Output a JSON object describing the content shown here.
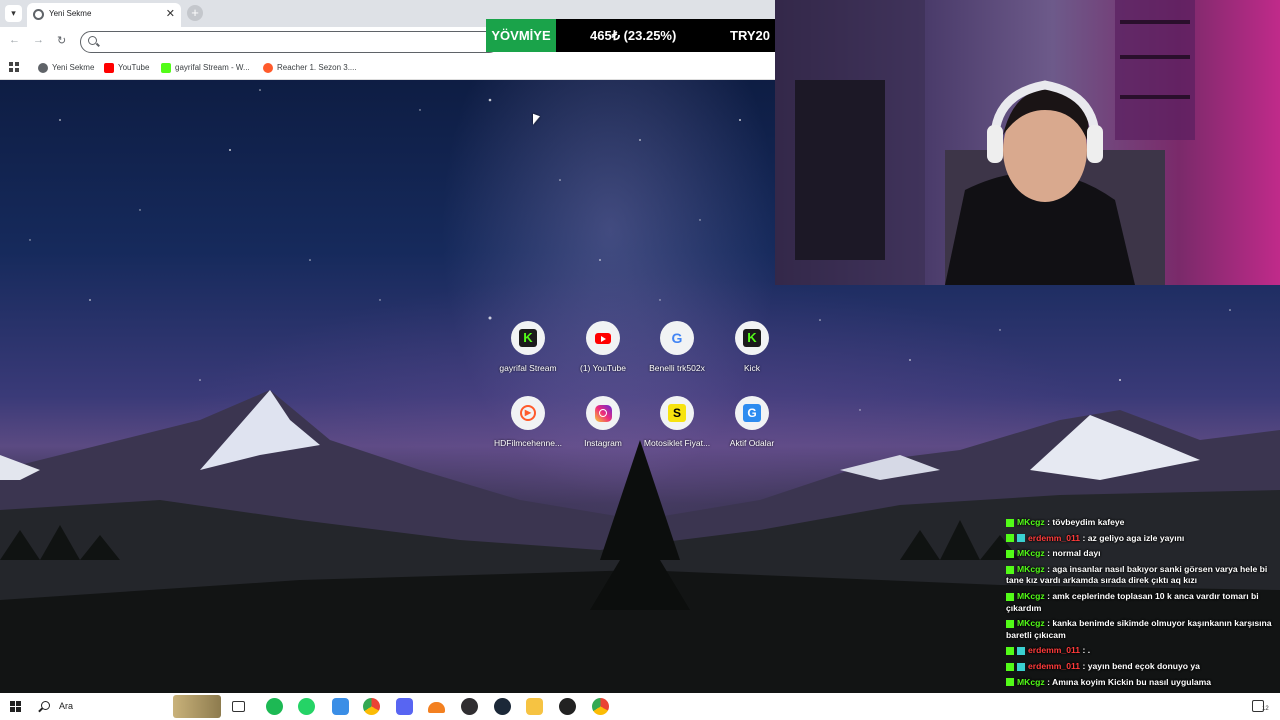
{
  "browser": {
    "tab_title": "Yeni Sekme",
    "new_tab_label": "+",
    "close_label": "✕",
    "address_placeholder": "",
    "bookmarks": [
      {
        "label": "Yeni Sekme"
      },
      {
        "label": "YouTube"
      },
      {
        "label": "gayrifal Stream - W..."
      },
      {
        "label": "Reacher 1. Sezon 3...."
      }
    ]
  },
  "ticker": {
    "label": "YÖVMİYE",
    "value": "465₺ (23.25%)",
    "next": "TRY20"
  },
  "shortcuts": [
    {
      "label": "gayrifal Stream",
      "icon": "kick-icon",
      "glyph": "K"
    },
    {
      "label": "(1) YouTube",
      "icon": "youtube-icon",
      "glyph": ""
    },
    {
      "label": "Benelli trk502x",
      "icon": "google-icon",
      "glyph": "G"
    },
    {
      "label": "Kick",
      "icon": "kick-icon",
      "glyph": "K"
    },
    {
      "label": "HDFilmcehenne...",
      "icon": "hdfilm-icon",
      "glyph": "▶"
    },
    {
      "label": "Instagram",
      "icon": "instagram-icon",
      "glyph": ""
    },
    {
      "label": "Motosiklet Fiyat...",
      "icon": "s-icon",
      "glyph": "S"
    },
    {
      "label": "Aktif Odalar",
      "icon": "g-icon",
      "glyph": "G"
    }
  ],
  "chat": [
    {
      "user": "MKcgz",
      "color": "green",
      "text": " : tövbeydim kafeye"
    },
    {
      "user": "erdemm_011",
      "color": "red",
      "text": " : az geliyo aga izle yayını"
    },
    {
      "user": "MKcgz",
      "color": "green",
      "text": " : normal dayı"
    },
    {
      "user": "MKcgz",
      "color": "green",
      "text": " : aga insanlar nasıl bakıyor sanki görsen varya hele bi tane kız vardı arkamda sırada direk çıktı aq kızı"
    },
    {
      "user": "MKcgz",
      "color": "green",
      "text": " : amk ceplerinde toplasan 10 k anca vardır tomarı bi çıkardım"
    },
    {
      "user": "MKcgz",
      "color": "green",
      "text": " : kanka benimde sikimde olmuyor kaşınkanın karşısına baretli çıkıcam"
    },
    {
      "user": "erdemm_011",
      "color": "red",
      "text": " : ."
    },
    {
      "user": "erdemm_011",
      "color": "red",
      "text": " : yayın bend eçok donuyo ya"
    },
    {
      "user": "MKcgz",
      "color": "green",
      "text": " : Amına koyim Kickin bu nasıl uygulama"
    }
  ],
  "taskbar": {
    "search_label": "Ara",
    "notification_count": "12"
  },
  "colors": {
    "kick_green": "#53fc18",
    "ticker_green": "#1aa34a",
    "chat_red": "#ff3b3b"
  }
}
